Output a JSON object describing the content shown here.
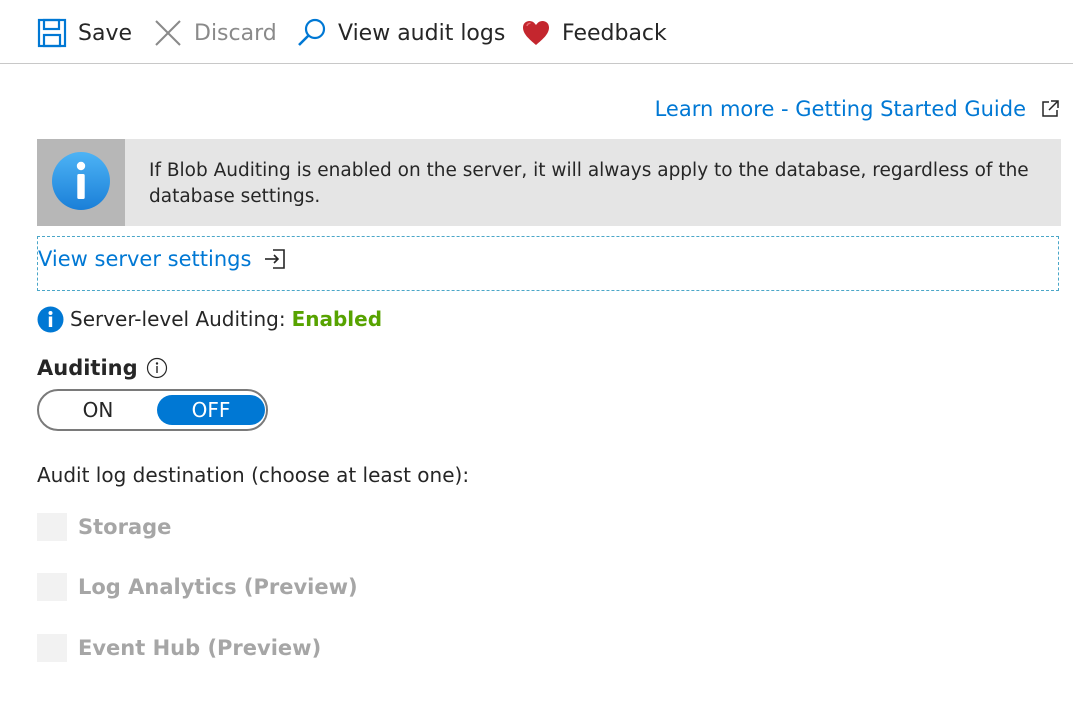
{
  "toolbar": {
    "save": {
      "label": "Save",
      "icon": "save-icon"
    },
    "discard": {
      "label": "Discard",
      "icon": "close-icon",
      "enabled": false
    },
    "view_audit_logs": {
      "label": "View audit logs",
      "icon": "search-icon"
    },
    "feedback": {
      "label": "Feedback",
      "icon": "heart-icon"
    }
  },
  "learn_more": {
    "label": "Learn more - Getting Started Guide",
    "icon": "external-link-icon"
  },
  "info_banner": {
    "icon": "info-icon",
    "text": "If Blob Auditing is enabled on the server, it will always apply to the database, regardless of the database settings."
  },
  "server_settings_link": {
    "label": "View server settings",
    "icon": "navigate-icon"
  },
  "server_status": {
    "label": "Server-level Auditing:",
    "value": "Enabled",
    "icon": "info-circle-icon"
  },
  "auditing": {
    "label": "Auditing",
    "icon": "info-outline-icon",
    "toggle": {
      "on_label": "ON",
      "off_label": "OFF",
      "selected": "OFF"
    }
  },
  "destination": {
    "label": "Audit log destination (choose at least one):",
    "options": [
      {
        "label": "Storage",
        "checked": false,
        "enabled": false
      },
      {
        "label": "Log Analytics (Preview)",
        "checked": false,
        "enabled": false
      },
      {
        "label": "Event Hub (Preview)",
        "checked": false,
        "enabled": false
      }
    ]
  },
  "colors": {
    "accent": "#0078d4",
    "enabled_green": "#57a300",
    "heart_red": "#c4262e",
    "disabled_text": "#a6a6a6"
  }
}
